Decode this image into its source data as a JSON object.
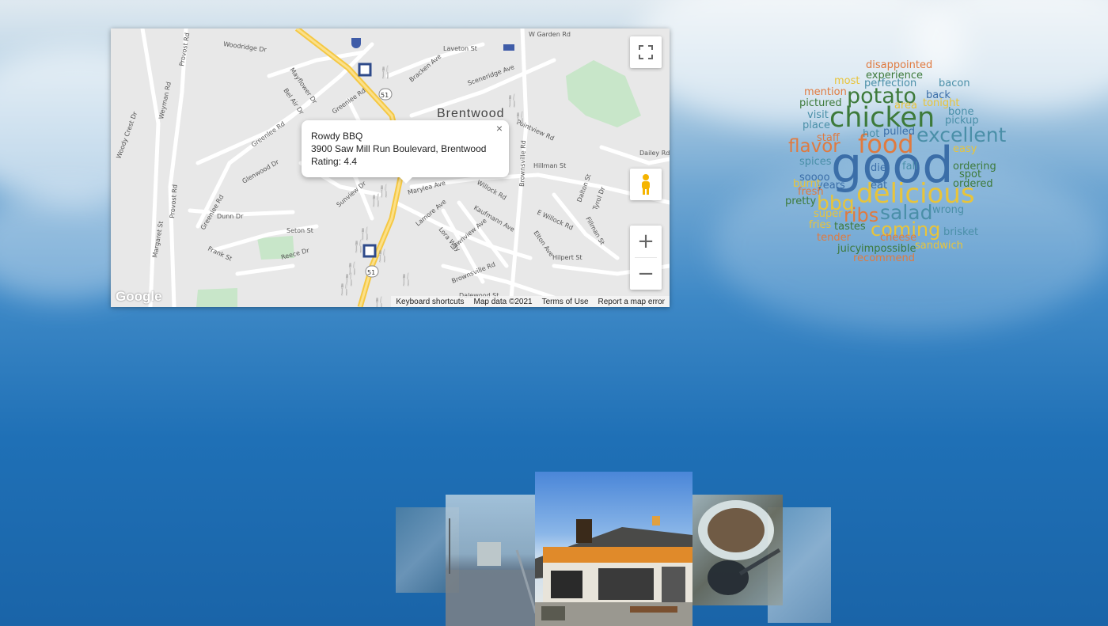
{
  "map": {
    "town_label": "Brentwood",
    "route_shield": "51",
    "streets": [
      "Woodridge Dr",
      "Provost Rd",
      "Weyman Rd",
      "Greenlee Rd",
      "Mayflower Dr",
      "Bel Air Dr",
      "Woody Crest Dr",
      "Glenwood Dr",
      "Provost Rd",
      "Dunn Dr",
      "Seton St",
      "Frank St",
      "Reece Dr",
      "Margaret St",
      "Bracken Ave",
      "Laveton St",
      "Sceneridge Ave",
      "W Garden Rd",
      "Brownsville Rd",
      "Pointview Rd",
      "Hillman St",
      "Dailey Rd",
      "Marylea Ave",
      "Willock Rd",
      "Kaufmann Ave",
      "Lamore Ave",
      "Lora Way",
      "Lawnview Ave",
      "E Willock Rd",
      "Elton Ave",
      "Fillman St",
      "Hilpert St",
      "Brownsville Rd",
      "Dalewood St",
      "Sunview Dr",
      "Dalton St",
      "Tyrol Dr"
    ],
    "info_window": {
      "name": "Rowdy BBQ",
      "address": "3900 Saw Mill Run Boulevard, Brentwood",
      "rating": "Rating: 4.4",
      "close_glyph": "×"
    },
    "footer": {
      "shortcuts": "Keyboard shortcuts",
      "data": "Map data ©2021",
      "terms": "Terms of Use",
      "report": "Report a map error"
    },
    "logo": "Google",
    "zoom_in": "+",
    "zoom_out": "−",
    "icons": [
      "fullscreen-icon",
      "pegman-icon",
      "restaurant-icon",
      "cafe-icon",
      "hotel-icon"
    ]
  },
  "word_cloud": {
    "words": [
      "disappointed",
      "experience",
      "perfection",
      "bacon",
      "mention",
      "potato",
      "tonight",
      "pictured",
      "area",
      "back",
      "chicken",
      "bone",
      "pickup",
      "visit",
      "place",
      "excellent",
      "flavor",
      "food",
      "easy",
      "good",
      "spices",
      "die",
      "fall",
      "ordering",
      "soooo",
      "delicious",
      "spot",
      "ordered",
      "pretty",
      "bbq",
      "years",
      "eat",
      "wrong",
      "super",
      "ribs",
      "salad",
      "fries",
      "tastes",
      "coming",
      "brisket",
      "tender",
      "impossible",
      "sandwich",
      "juicy",
      "recommend",
      "fresh",
      "hot",
      "pulled",
      "staff",
      "lunch",
      "most",
      "tonight",
      "burnt",
      "cheese"
    ]
  },
  "colors": {
    "blue_word": "#3b6ea8",
    "green_word": "#3d7a3a",
    "orange_word": "#e07a3f",
    "yellow_word": "#e8c43a",
    "teal_word": "#4a8fa8"
  }
}
